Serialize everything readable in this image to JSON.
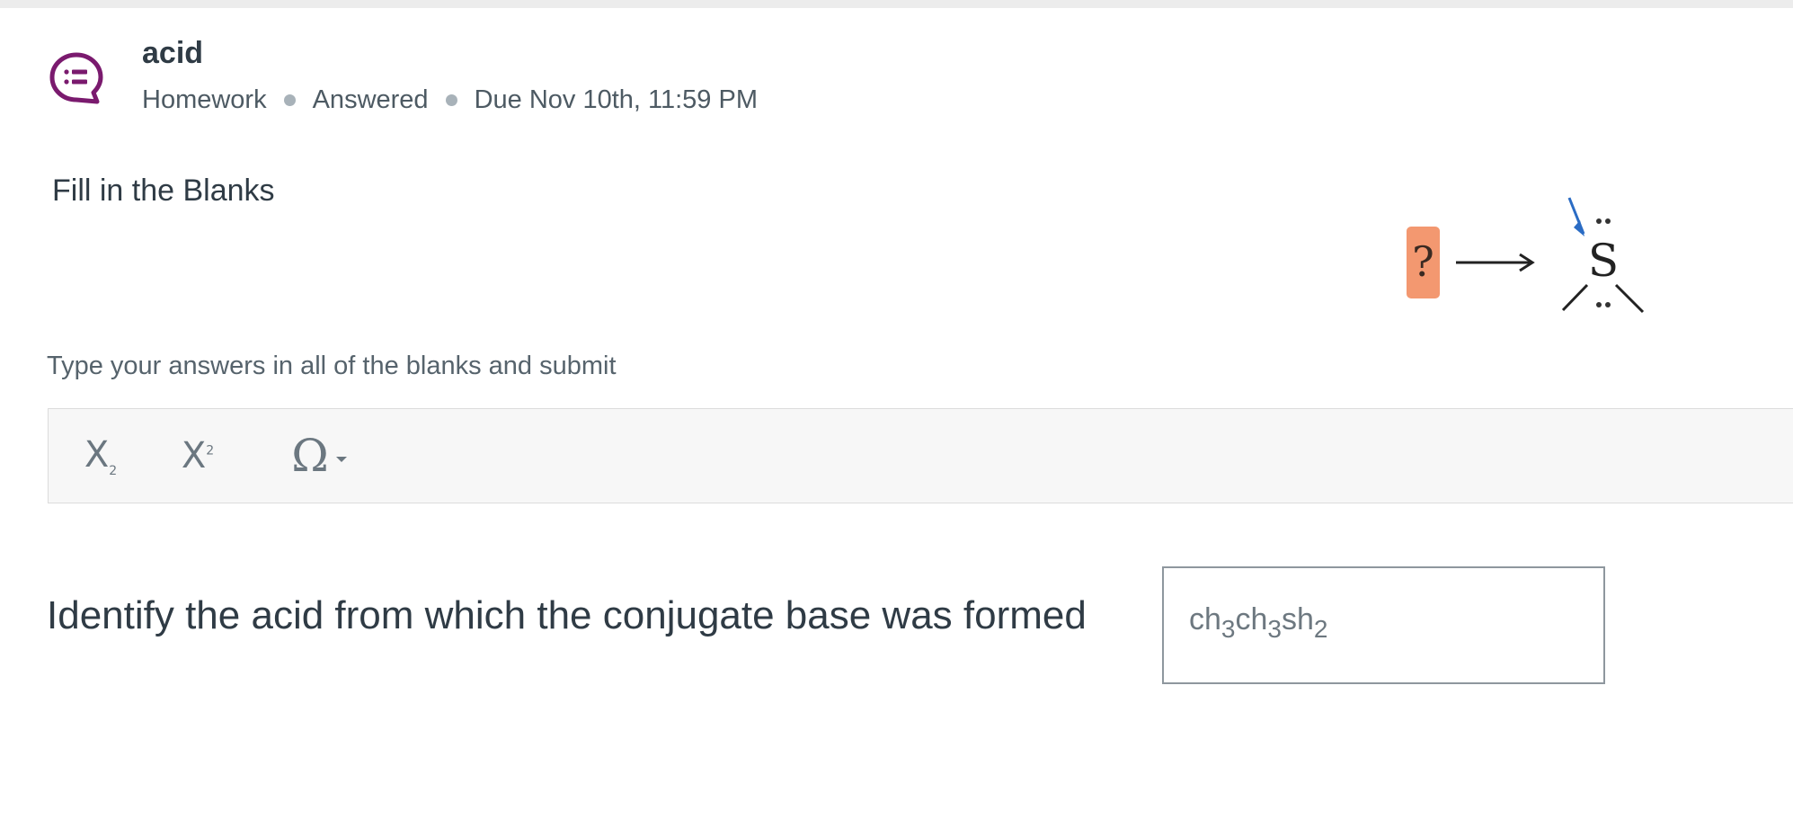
{
  "header": {
    "title": "acid",
    "meta": [
      "Homework",
      "Answered",
      "Due Nov 10th, 11:59 PM"
    ],
    "accent_color": "#7a1a6e"
  },
  "question": {
    "type_label": "Fill in the Blanks",
    "figure": {
      "placeholder_mark": "?",
      "atom": "S",
      "placeholder_color": "#f39870",
      "arrow_color": "#2b6cc4"
    },
    "instructions": "Type your answers in all of the blanks and submit",
    "toolbar": {
      "subscript_label": "X",
      "subscript_mark": "2",
      "superscript_label": "X",
      "superscript_mark": "2",
      "special_char_label": "Ω"
    },
    "prompt": "Identify the acid from which the conjugate base was formed",
    "answer_parts": [
      "ch",
      "3",
      "ch",
      "3",
      "sh",
      "2"
    ]
  }
}
